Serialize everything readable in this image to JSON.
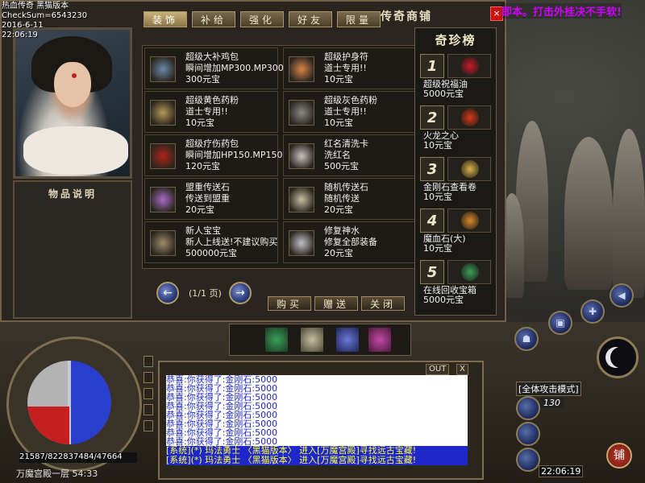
{
  "hud_top": {
    "line1": "热血传奇 黑猫版本",
    "line2": "CheckSum=6543230",
    "line3": "2016-6-11",
    "line4": "22:06:19"
  },
  "banner": "即本。打击外挂决不手软!",
  "shop": {
    "title": "传奇商铺",
    "close": "×",
    "tabs": [
      {
        "label": "装饰",
        "active": true
      },
      {
        "label": "补给",
        "active": false
      },
      {
        "label": "强化",
        "active": false
      },
      {
        "label": "好友",
        "active": false
      },
      {
        "label": "限量",
        "active": false
      }
    ],
    "description_title": "物品说明",
    "items": [
      {
        "name": "超级大补鸡包",
        "desc": "瞬间增加MP300.MP300",
        "price": "300元宝",
        "icon": "bag-icon",
        "color": "#6a8aa6"
      },
      {
        "name": "超级护身符",
        "desc": "道士专用!!",
        "price": "10元宝",
        "icon": "talisman-icon",
        "color": "#d9844a"
      },
      {
        "name": "超级黄色药粉",
        "desc": "道士专用!!",
        "price": "10元宝",
        "icon": "powder-bag-icon",
        "color": "#b59a56"
      },
      {
        "name": "超级灰色药粉",
        "desc": "道士专用!!",
        "price": "10元宝",
        "icon": "powder-bag-icon",
        "color": "#8a8a84"
      },
      {
        "name": "超级疗伤药包",
        "desc": "瞬间增加HP150.MP150",
        "price": "120元宝",
        "icon": "jar-icon",
        "color": "#b02418"
      },
      {
        "name": "红名清洗卡",
        "desc": "洗红名",
        "price": "500元宝",
        "icon": "card-icon",
        "color": "#c8c0c0"
      },
      {
        "name": "盟重传送石",
        "desc": "传送到盟重",
        "price": "20元宝",
        "icon": "stone-icon",
        "color": "#a86cc8"
      },
      {
        "name": "随机传送石",
        "desc": "随机传送",
        "price": "20元宝",
        "icon": "stone-icon",
        "color": "#c8bfa0"
      },
      {
        "name": "新人宝宝",
        "desc": "新人上线送!不建议购买",
        "price": "500000元宝",
        "icon": "book-icon",
        "color": "#9d8a6a"
      },
      {
        "name": "修复神水",
        "desc": "修复全部装备",
        "price": "20元宝",
        "icon": "potion-icon",
        "color": "#c0c0c8"
      }
    ],
    "page_label": "(1/1 页)",
    "buttons": {
      "buy": "购买",
      "gift": "赠送",
      "close": "关闭"
    },
    "prev": "←",
    "next": "→"
  },
  "rank": {
    "title": "奇珍榜",
    "items": [
      {
        "num": "1",
        "name": "超级祝福油",
        "price": "5000元宝",
        "icon": "oil-bottle-icon",
        "color": "#c41e2a"
      },
      {
        "num": "2",
        "name": "火龙之心",
        "price": "10元宝",
        "icon": "dragon-heart-icon",
        "color": "#d63a1a"
      },
      {
        "num": "3",
        "name": "金刚石查看卷",
        "price": "10元宝",
        "icon": "scroll-icon",
        "color": "#d9b24a"
      },
      {
        "num": "4",
        "name": "魔血石(大)",
        "price": "10元宝",
        "icon": "blood-stone-icon",
        "color": "#d98a2a"
      },
      {
        "num": "5",
        "name": "在线回收宝箱",
        "price": "5000元宝",
        "icon": "treasure-chest-icon",
        "color": "#3aa05a"
      }
    ]
  },
  "hud": {
    "stats": "21587/822837484/47664",
    "location": "万魔宫殿一层 54:33",
    "attack_mode": "[全体攻击模式]",
    "level": "130",
    "clock": "22:06:19",
    "shop_button": "铺",
    "chat_tabs": [
      "OUT",
      "X"
    ],
    "hp_fraction": 0.45
  },
  "chat": {
    "messages": [
      {
        "text": "恭喜:你获得了:金刚石:5000",
        "system": false
      },
      {
        "text": "恭喜:你获得了:金刚石:5000",
        "system": false
      },
      {
        "text": "恭喜:你获得了:金刚石:5000",
        "system": false
      },
      {
        "text": "恭喜:你获得了:金刚石:5000",
        "system": false
      },
      {
        "text": "恭喜:你获得了:金刚石:5000",
        "system": false
      },
      {
        "text": "恭喜:你获得了:金刚石:5000",
        "system": false
      },
      {
        "text": "恭喜:你获得了:金刚石:5000",
        "system": false
      },
      {
        "text": "恭喜:你获得了:金刚石:5000",
        "system": false
      },
      {
        "text": "[系统](*) 玛法勇士 〈黑猫版本〉 进入[万魔宫殿]寻找远古宝藏!",
        "system": true
      },
      {
        "text": "[系统](*) 玛法勇士 〈黑猫版本〉 进入[万魔宫殿]寻找远古宝藏!",
        "system": true
      }
    ]
  }
}
